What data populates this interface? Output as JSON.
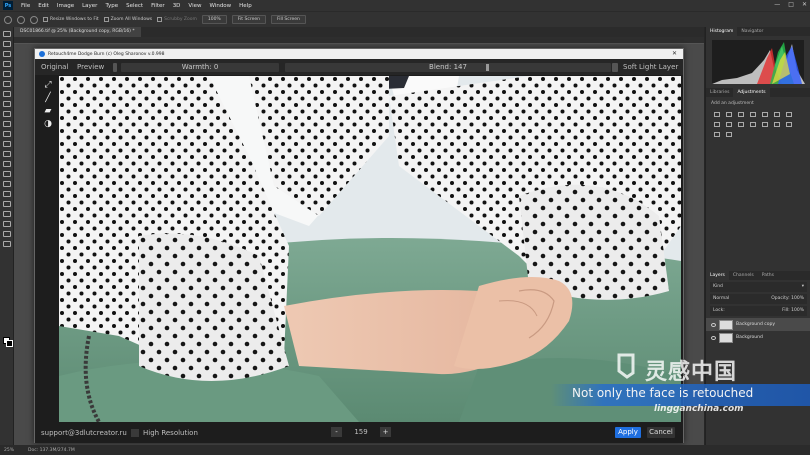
{
  "app": {
    "menu": [
      "File",
      "Edit",
      "Image",
      "Layer",
      "Type",
      "Select",
      "Filter",
      "3D",
      "View",
      "Window",
      "Help"
    ],
    "window_controls": [
      "—",
      "□",
      "✕"
    ]
  },
  "options_bar": {
    "resize_windows": "Resize Windows to Fit",
    "zoom_all": "Zoom All Windows",
    "scrubby_zoom": "Scrubby Zoom",
    "zoom_level": "100%",
    "fit_screen": "Fit Screen",
    "fill_screen": "Fill Screen"
  },
  "document_tab": "DSC01866.tif @ 25% (Background copy, RGB/16) *",
  "plugin": {
    "title": "Retouch4me Dodge Burn (c) Oleg Sharonov v.0.998",
    "original_label": "Original",
    "preview_label": "Preview",
    "warmth_label": "Warmth: 0",
    "blend_label": "Blend: 147",
    "blend_value": 147,
    "soft_light_label": "Soft Light Layer",
    "support_email": "support@3dlutcreator.ru",
    "high_res_label": "High Resolution",
    "minus_label": "-",
    "plus_label": "+",
    "stepper_value": "159",
    "apply_label": "Apply",
    "cancel_label": "Cancel"
  },
  "panels": {
    "histogram_tabs": [
      "Histogram",
      "Navigator"
    ],
    "adjust_tabs": [
      "Libraries",
      "Adjustments"
    ],
    "add_adjustment": "Add an adjustment",
    "layer_tabs": [
      "Layers",
      "Channels",
      "Paths"
    ],
    "kind_label": "Kind",
    "blend_mode": "Normal",
    "opacity_label": "Opacity:",
    "opacity_value": "100%",
    "lock_label": "Lock:",
    "fill_label": "Fill:",
    "fill_value": "100%",
    "layers": [
      {
        "name": "Background copy",
        "selected": true
      },
      {
        "name": "Background",
        "selected": false
      }
    ]
  },
  "status": {
    "zoom": "25%",
    "doc": "Doc: 137.3M/274.7M"
  },
  "overlay": {
    "subtitle": "Not only the face is retouched",
    "watermark_cn": "灵感中国",
    "watermark_url": "lingganchina.com"
  },
  "colors": {
    "accent_blue": "#1f6fe0",
    "ps_dark": "#323232",
    "sweater_green": "#7aa88f"
  }
}
